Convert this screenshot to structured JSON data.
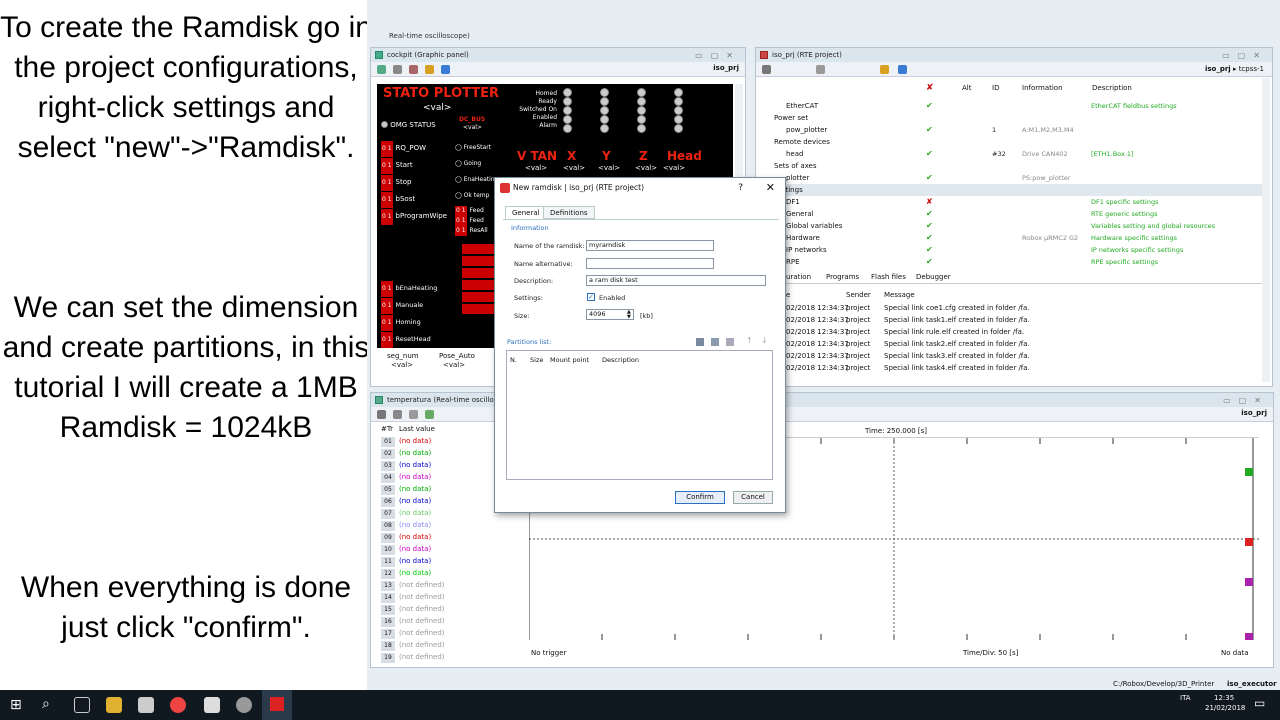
{
  "tutorial": {
    "para1": "To create the Ramdisk go in the project configurations, right-click settings and select \"new\"->\"Ramdisk\".",
    "para2": "We can set the dimension and create partitions, in this tutorial I will create a 1MB Ramdisk = 1024kB",
    "para3": "When everything is done just click \"confirm\"."
  },
  "top_strip": "Real-time oscilloscope)",
  "cockpit": {
    "title": "cockpit (Graphic panel)",
    "project": "iso_prj",
    "header": "STATO PLOTTER",
    "val": "<val>",
    "omg_status": "OMG STATUS",
    "dc_bus": "DC_BUS",
    "status_labels": [
      "Homed",
      "Ready",
      "Switched On",
      "Enabled",
      "Alarm"
    ],
    "buttons": [
      "RQ_POW",
      "Start",
      "Stop",
      "bSost",
      "bProgramWipe"
    ],
    "right_items": [
      "FreeStart",
      "Going",
      "EnaHeating",
      "Ok temp"
    ],
    "feeds": [
      "Feed",
      "Feed",
      "ResAll"
    ],
    "axes": [
      "V TAN",
      "X",
      "Y",
      "Z",
      "Head"
    ],
    "lower_buttons": [
      "bEnaHeating",
      "Manuale",
      "Homing",
      "ResetHead"
    ],
    "seg_num": "seg_num",
    "pose_auto": "Pose_Auto"
  },
  "rte": {
    "title": "iso_prj (RTE project)",
    "project_path": "iso_prj",
    "target": "tcpss-1",
    "columns": [
      "Alt",
      "ID",
      "Information",
      "Description"
    ],
    "rows": [
      {
        "label": "EtherCAT",
        "id": "",
        "info": "",
        "desc": "EtherCAT fieldbus settings",
        "ok": true
      },
      {
        "label": "Power set",
        "id": "",
        "info": "",
        "desc": "",
        "ok": null
      },
      {
        "label": "pow_plotter",
        "id": "1",
        "info": "A:M1,M2,M3,M4",
        "desc": "",
        "ok": true
      },
      {
        "label": "Remote devices",
        "id": "",
        "info": "",
        "desc": "",
        "ok": null
      },
      {
        "label": "head",
        "id": "#32",
        "info": "Drive CAN402",
        "desc": "[ETH1.Box 1]",
        "ok": true
      },
      {
        "label": "Sets of axes",
        "id": "",
        "info": "",
        "desc": "",
        "ok": null
      },
      {
        "label": "plotter",
        "id": "",
        "info": "PS:pow_plotter",
        "desc": "",
        "ok": true
      },
      {
        "label": "Settings",
        "id": "",
        "info": "",
        "desc": "",
        "ok": null
      },
      {
        "label": "DF1",
        "id": "",
        "info": "",
        "desc": "DF1 specific settings",
        "ok": false
      },
      {
        "label": "General",
        "id": "",
        "info": "",
        "desc": "RTE generic settings",
        "ok": true
      },
      {
        "label": "Global variables",
        "id": "",
        "info": "",
        "desc": "Variables setting and global resources",
        "ok": true
      },
      {
        "label": "Hardware",
        "id": "",
        "info": "Robox μRMC2 G2",
        "desc": "Hardware specific settings",
        "ok": true
      },
      {
        "label": "IP networks",
        "id": "",
        "info": "",
        "desc": "IP networks specific settings",
        "ok": true
      },
      {
        "label": "RPE",
        "id": "",
        "info": "",
        "desc": "RPE specific settings",
        "ok": true
      }
    ],
    "tabs": [
      "uration",
      "Programs",
      "Flash files",
      "Debugger"
    ],
    "msg_columns": [
      "e",
      "Sender",
      "Message"
    ],
    "messages": [
      {
        "time": "02/2018 12:34:37",
        "sender": "project",
        "text": "Special link coe1.cfg created in folder /fa."
      },
      {
        "time": "02/2018 12:34:37",
        "sender": "project",
        "text": "Special link task1.elf created in folder /fa."
      },
      {
        "time": "02/2018 12:34:37",
        "sender": "project",
        "text": "Special link rule.elf created in folder /fa."
      },
      {
        "time": "02/2018 12:34:37",
        "sender": "project",
        "text": "Special link task2.elf created in folder /fa."
      },
      {
        "time": "02/2018 12:34:37",
        "sender": "project",
        "text": "Special link task3.elf created in folder /fa."
      },
      {
        "time": "02/2018 12:34:37",
        "sender": "project",
        "text": "Special link task4.elf created in folder /fa."
      }
    ]
  },
  "temp": {
    "title": "temperatura (Real-time oscilloscope)",
    "project": "iso_prj",
    "col_tr": "#Tr",
    "col_last": "Last value",
    "rows": [
      {
        "n": "01",
        "v": "(no data)",
        "c": "#d00"
      },
      {
        "n": "02",
        "v": "(no data)",
        "c": "#0a0"
      },
      {
        "n": "03",
        "v": "(no data)",
        "c": "#00c"
      },
      {
        "n": "04",
        "v": "(no data)",
        "c": "#c0c"
      },
      {
        "n": "05",
        "v": "(no data)",
        "c": "#0a0"
      },
      {
        "n": "06",
        "v": "(no data)",
        "c": "#00c"
      },
      {
        "n": "07",
        "v": "(no data)",
        "c": "#6c6"
      },
      {
        "n": "08",
        "v": "(no data)",
        "c": "#88f"
      },
      {
        "n": "09",
        "v": "(no data)",
        "c": "#d00"
      },
      {
        "n": "10",
        "v": "(no data)",
        "c": "#c0c"
      },
      {
        "n": "11",
        "v": "(no data)",
        "c": "#00c"
      },
      {
        "n": "12",
        "v": "(no data)",
        "c": "#0c0"
      },
      {
        "n": "13",
        "v": "(not defined)",
        "c": "#999"
      },
      {
        "n": "14",
        "v": "(not defined)",
        "c": "#999"
      },
      {
        "n": "15",
        "v": "(not defined)",
        "c": "#999"
      },
      {
        "n": "16",
        "v": "(not defined)",
        "c": "#999"
      },
      {
        "n": "17",
        "v": "(not defined)",
        "c": "#999"
      },
      {
        "n": "18",
        "v": "(not defined)",
        "c": "#999"
      },
      {
        "n": "19",
        "v": "(not defined)",
        "c": "#999"
      }
    ],
    "time_label": "Time: 250.000 [s]",
    "trigger": "No trigger",
    "time_div": "Time/Div: 50 [s]",
    "no_data": "No data"
  },
  "dialog": {
    "title": "New ramdisk | iso_prj (RTE project)",
    "help": "?",
    "close": "✕",
    "tab_general": "General",
    "tab_definitions": "Definitions",
    "section_info": "Information",
    "name_label": "Name of the ramdisk:",
    "name_value": "myramdisk",
    "alt_label": "Name alternative:",
    "alt_value": "",
    "desc_label": "Description:",
    "desc_value": "a ram disk test",
    "settings_label": "Settings:",
    "enabled_label": "Enabled",
    "size_label": "Size:",
    "size_value": "4096",
    "size_unit": "[kb]",
    "partitions_label": "Partitions list:",
    "part_columns": [
      "N.",
      "Size",
      "Mount point",
      "Description"
    ],
    "confirm": "Confirm",
    "cancel": "Cancel"
  },
  "statusbar": {
    "path": "C:/Robox/Develop/3D_Printer",
    "exec": "iso_executor"
  },
  "taskbar": {
    "lang": "ITA",
    "time": "12:35",
    "date": "21/02/2018"
  }
}
